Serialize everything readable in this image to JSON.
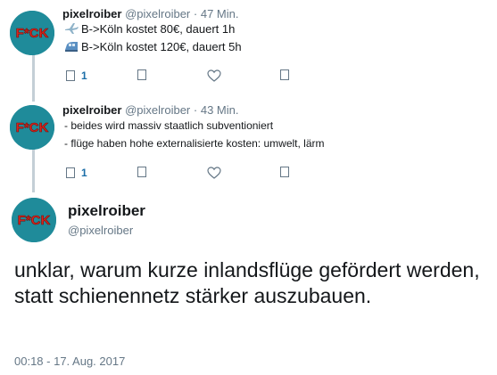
{
  "tweets": [
    {
      "name": "pixelroiber",
      "handle": "@pixelroiber",
      "separator": "·",
      "time": "47 Min.",
      "lines": [
        {
          "icon": "airplane-icon",
          "text": "B->Köln kostet 80€, dauert 1h"
        },
        {
          "icon": "train-icon",
          "text": "B->Köln kostet 120€, dauert 5h"
        }
      ],
      "reply_count": "1"
    },
    {
      "name": "pixelroiber",
      "handle": "@pixelroiber",
      "separator": "·",
      "time": "43 Min.",
      "lines": [
        {
          "text": "- beides wird massiv staatlich subventioniert"
        },
        {
          "text": "- flüge haben hohe externalisierte kosten: umwelt, lärm"
        }
      ],
      "reply_count": "1"
    }
  ],
  "main_tweet": {
    "name": "pixelroiber",
    "handle": "@pixelroiber",
    "text": "unklar, warum kurze inlandsflüge gefördert werden, statt schienennetz stärker auszubauen.",
    "timestamp": "00:18 - 17. Aug. 2017"
  },
  "avatar": {
    "text": "F*CK",
    "background": "#1f8b9a",
    "text_color": "#d9251d"
  },
  "colors": {
    "thread_line": "#c4cfd6",
    "muted": "#657786",
    "reply_count": "#1c6ea8"
  }
}
